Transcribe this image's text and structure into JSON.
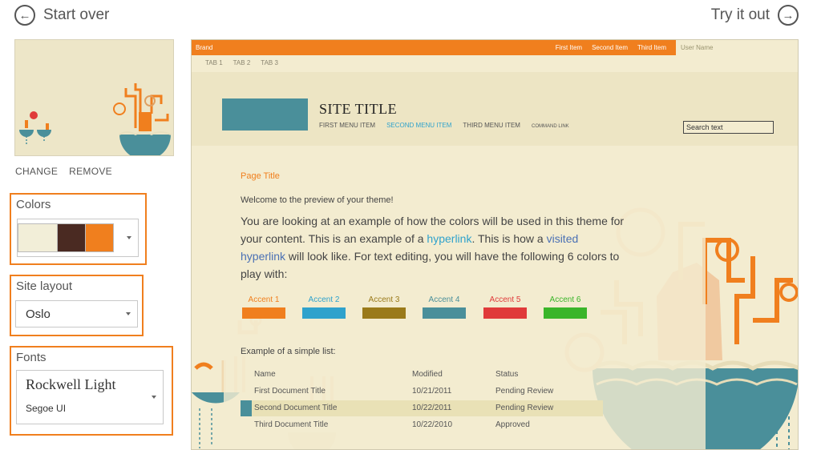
{
  "header": {
    "start_over": "Start over",
    "try_it_out": "Try it out"
  },
  "left": {
    "change": "CHANGE",
    "remove": "REMOVE",
    "colors_label": "Colors",
    "color_swatches": [
      "#f2eed8",
      "#4a2a22",
      "#f07f1e"
    ],
    "layout_label": "Site layout",
    "layout_value": "Oslo",
    "fonts_label": "Fonts",
    "font_heading": "Rockwell Light",
    "font_body": "Segoe UI"
  },
  "preview": {
    "brand": "Brand",
    "nav": [
      "First Item",
      "Second Item",
      "Third Item"
    ],
    "user_name": "User Name",
    "tabs": [
      "TAB 1",
      "TAB 2",
      "TAB 3"
    ],
    "site_title": "SITE TITLE",
    "menu": [
      "FIRST MENU ITEM",
      "SECOND MENU ITEM",
      "THIRD MENU ITEM",
      "COMMAND LINK"
    ],
    "search_text": "Search text",
    "page_title": "Page Title",
    "welcome": "Welcome to the preview of your theme!",
    "para_1": "You are looking at an example of how the colors will be used in this theme for your content. This is an example of a ",
    "hyperlink": "hyperlink",
    "para_2": ". This is how a ",
    "visited_hyperlink": "visited hyperlink",
    "para_3": " will look like. For text editing, you will have the following 6 colors to play with:",
    "accents": [
      {
        "label": "Accent 1",
        "color": "#f07f1e"
      },
      {
        "label": "Accent 2",
        "color": "#2fa2cc"
      },
      {
        "label": "Accent 3",
        "color": "#9a7a1a"
      },
      {
        "label": "Accent 4",
        "color": "#4a8f9a"
      },
      {
        "label": "Accent 5",
        "color": "#e03a3a"
      },
      {
        "label": "Accent 6",
        "color": "#3ab52a"
      }
    ],
    "list_title": "Example of a simple list:",
    "list_headers": [
      "Name",
      "Modified",
      "Status"
    ],
    "list_rows": [
      [
        "First Document Title",
        "10/21/2011",
        "Pending Review"
      ],
      [
        "Second Document Title",
        "10/22/2011",
        "Pending Review"
      ],
      [
        "Third Document Title",
        "10/22/2010",
        "Approved"
      ]
    ]
  }
}
